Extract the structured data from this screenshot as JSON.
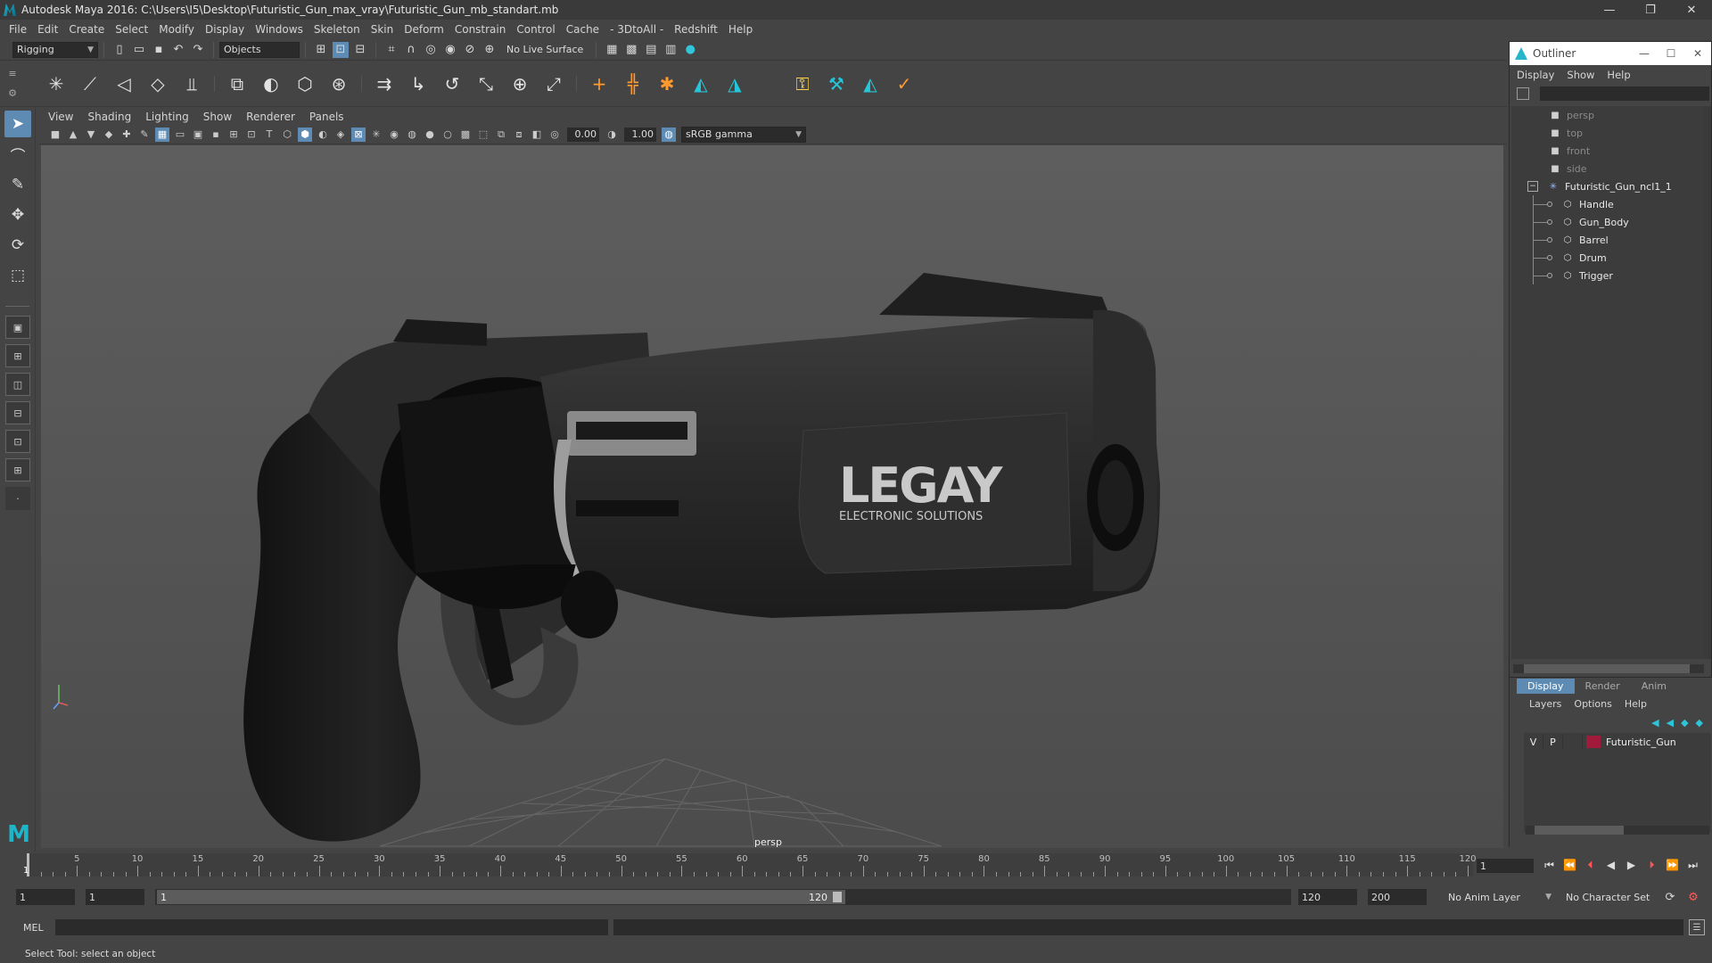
{
  "window": {
    "title": "Autodesk Maya 2016: C:\\Users\\I5\\Desktop\\Futuristic_Gun_max_vray\\Futuristic_Gun_mb_standart.mb",
    "minimize": "—",
    "maximize": "❐",
    "close": "✕"
  },
  "menubar": [
    "File",
    "Edit",
    "Create",
    "Select",
    "Modify",
    "Display",
    "Windows",
    "Skeleton",
    "Skin",
    "Deform",
    "Constrain",
    "Control",
    "Cache",
    "- 3DtoAll -",
    "Redshift",
    "Help"
  ],
  "statusline": {
    "menuset": "Rigging",
    "selection_mode": "Objects",
    "live_surface": "No Live Surface"
  },
  "viewport": {
    "menu": [
      "View",
      "Shading",
      "Lighting",
      "Show",
      "Renderer",
      "Panels"
    ],
    "exposure": "0.00",
    "gamma": "1.00",
    "color_space": "sRGB gamma",
    "camera_label": "persp",
    "logo_text": "LEGAY",
    "logo_sub": "ELECTRONIC SOLUTIONS"
  },
  "outliner": {
    "title": "Outliner",
    "menu": [
      "Display",
      "Show",
      "Help"
    ],
    "cameras": [
      "persp",
      "top",
      "front",
      "side"
    ],
    "group": "Futuristic_Gun_ncl1_1",
    "children": [
      "Handle",
      "Gun_Body",
      "Barrel",
      "Drum",
      "Trigger"
    ],
    "win_min": "—",
    "win_max": "☐",
    "win_close": "✕"
  },
  "layer_editor": {
    "tabs": [
      "Display",
      "Render",
      "Anim"
    ],
    "menu": [
      "Layers",
      "Options",
      "Help"
    ],
    "layers": [
      {
        "v": "V",
        "p": "P",
        "name": "Futuristic_Gun",
        "color": "#a01a3a"
      }
    ]
  },
  "timeslider": {
    "ticks": [
      5,
      10,
      15,
      20,
      25,
      30,
      35,
      40,
      45,
      50,
      55,
      60,
      65,
      70,
      75,
      80,
      85,
      90,
      95,
      100,
      105,
      110,
      115,
      120
    ],
    "start": 1,
    "end": 120,
    "current_frame": "1",
    "current_frame_label": "1"
  },
  "rangeslider": {
    "start_time": "1",
    "playback_start": "1",
    "range_start": "1",
    "range_end": "120",
    "playback_end": "120",
    "end_time": "200",
    "anim_layer": "No Anim Layer",
    "character_set": "No Character Set"
  },
  "cmdline": {
    "label": "MEL"
  },
  "helpline": {
    "text": "Select Tool: select an object"
  }
}
